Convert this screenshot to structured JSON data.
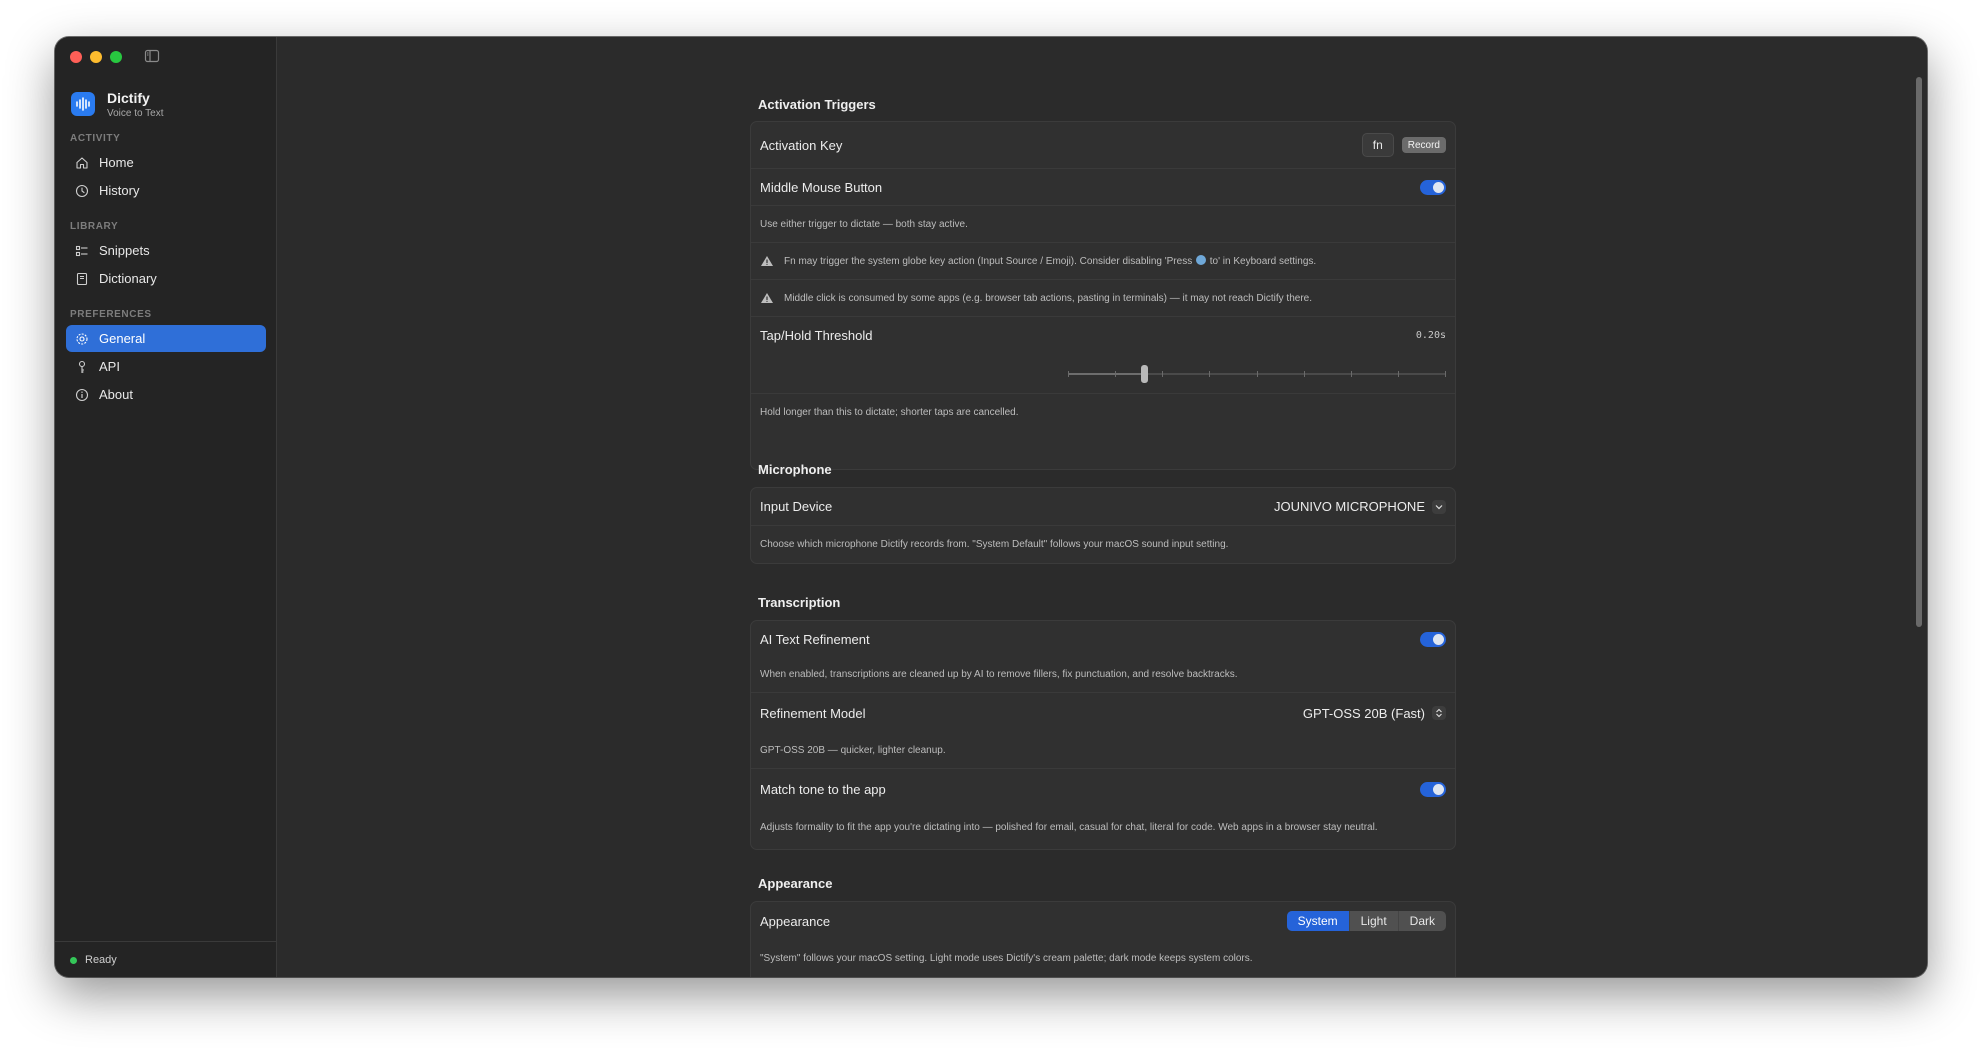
{
  "brand": {
    "name": "Dictify",
    "subtitle": "Voice to Text"
  },
  "sidebar": {
    "sections": [
      {
        "label": "ACTIVITY",
        "items": [
          {
            "label": "Home",
            "icon": "house-icon"
          },
          {
            "label": "History",
            "icon": "clock-icon"
          }
        ]
      },
      {
        "label": "LIBRARY",
        "items": [
          {
            "label": "Snippets",
            "icon": "list-icon"
          },
          {
            "label": "Dictionary",
            "icon": "book-icon"
          }
        ]
      },
      {
        "label": "PREFERENCES",
        "items": [
          {
            "label": "General",
            "icon": "gear-icon",
            "active": true
          },
          {
            "label": "API",
            "icon": "key-icon"
          },
          {
            "label": "About",
            "icon": "info-icon"
          }
        ]
      }
    ],
    "status": {
      "text": "Ready",
      "color": "#34c759"
    }
  },
  "activation": {
    "title": "Activation Triggers",
    "activation_key": {
      "label": "Activation Key",
      "key": "fn",
      "record_label": "Record"
    },
    "middle_mouse": {
      "label": "Middle Mouse Button",
      "enabled": true
    },
    "note": "Use either trigger to dictate — both stay active.",
    "warning_fn": {
      "before": "Fn may trigger the system globe key action (Input Source / Emoji). Consider disabling 'Press ",
      "after": " to' in Keyboard settings."
    },
    "warning_middle": "Middle click is consumed by some apps (e.g. browser tab actions, pasting in terminals) — it may not reach Dictify there.",
    "threshold": {
      "label": "Tap/Hold Threshold",
      "value_text": "0.20s",
      "fraction": 0.2,
      "ticks": 9
    },
    "threshold_note": "Hold longer than this to dictate; shorter taps are cancelled."
  },
  "microphone": {
    "title": "Microphone",
    "input_device": {
      "label": "Input Device",
      "value": "JOUNIVO MICROPHONE"
    },
    "note": "Choose which microphone Dictify records from. \"System Default\" follows your macOS sound input setting."
  },
  "transcription": {
    "title": "Transcription",
    "ai_refinement": {
      "label": "AI Text Refinement",
      "enabled": true
    },
    "ai_note": "When enabled, transcriptions are cleaned up by AI to remove fillers, fix punctuation, and resolve backtracks.",
    "model": {
      "label": "Refinement Model",
      "value": "GPT-OSS 20B (Fast)"
    },
    "model_note": "GPT-OSS 20B — quicker, lighter cleanup.",
    "match_tone": {
      "label": "Match tone to the app",
      "enabled": true
    },
    "tone_note": "Adjusts formality to fit the app you're dictating into — polished for email, casual for chat, literal for code. Web apps in a browser stay neutral."
  },
  "appearance": {
    "title": "Appearance",
    "row_label": "Appearance",
    "options": [
      "System",
      "Light",
      "Dark"
    ],
    "selected": "System",
    "note": "\"System\" follows your macOS setting. Light mode uses Dictify's cream palette; dark mode keeps system colors."
  },
  "colors": {
    "accent": "#2f6fd8",
    "toggle_on": "#2563d9",
    "status_ready": "#34c759"
  }
}
